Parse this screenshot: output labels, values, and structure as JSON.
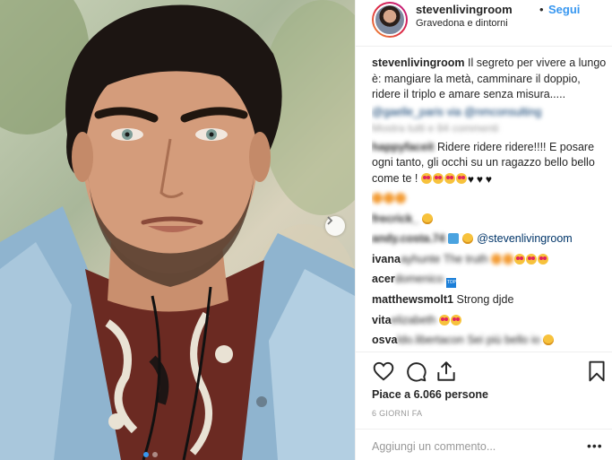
{
  "post": {
    "username": "stevenlivingroom",
    "bullet": "•",
    "follow_label": "Segui",
    "location": "Gravedona e dintorni",
    "caption": {
      "username": "stevenlivingroom",
      "text": "Il segreto per vivere a lungo è: mangiare la metà, camminare il doppio, ridere il triplo e amare senza misura.....",
      "tags": "@gaelle_paris via @nmconsulting"
    },
    "show_all_label": "Mostra tutti e 84 commenti",
    "comments": [
      {
        "user": "happyfaceit",
        "text": "Ridere ridere ridere!!!! E posare ogni tanto, gli occhi su un ragazzo bello bello come te !",
        "emojis": [
          "face-with-hearts",
          "face-with-hearts",
          "face-with-hearts",
          "face-with-hearts",
          "heart",
          "heart",
          "heart"
        ]
      },
      {
        "user": "",
        "text": "",
        "emojis": [
          "face-orange",
          "face-orange",
          "face-orange"
        ]
      },
      {
        "user": "frecrick_",
        "text": "",
        "emojis": [
          "clapping-hands"
        ]
      },
      {
        "user": "andy.costa.74",
        "text": "@stevenlivingroom",
        "emojis": [
          "blue-square",
          "clapping-hands"
        ]
      },
      {
        "user": "ivana",
        "blurred": "ayhunte The truth",
        "text": "",
        "emojis": [
          "face-orange",
          "face-orange",
          "heart-eyes",
          "heart-eyes",
          "heart-eyes"
        ]
      },
      {
        "user": "acer",
        "blurred": "domenico",
        "text": "",
        "emojis": [
          "top-icon"
        ]
      },
      {
        "user": "matthewsmolt1",
        "text": "Strong djde",
        "emojis": []
      },
      {
        "user": "vita",
        "blurred": "elizabeth",
        "text": "",
        "emojis": [
          "heart-eyes",
          "heart-eyes"
        ]
      },
      {
        "user": "osva",
        "blurred": "ldo.libertacon",
        "text": "Sei più bello io",
        "emojis": [
          "smirk"
        ]
      }
    ],
    "likes": "Piace a 6.066 persone",
    "timestamp": "6 GIORNI FA",
    "add_comment_placeholder": "Aggiungi un commento...",
    "more_options": "•••",
    "icons": {
      "like": "heart-icon",
      "comment": "comment-icon",
      "share": "share-icon",
      "save": "bookmark-icon",
      "next": "chevron-right-icon"
    },
    "colors": {
      "accent": "#3897f0",
      "text": "#262626",
      "muted": "#999999",
      "border": "#efefef"
    },
    "carousel": {
      "slides": 2,
      "active": 1
    }
  }
}
